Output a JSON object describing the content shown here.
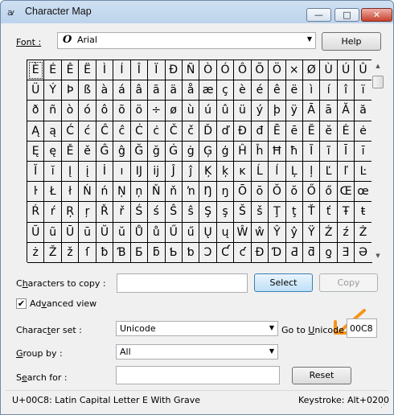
{
  "window": {
    "title": "Character Map",
    "icon": "charmap-icon",
    "controls": {
      "minimize": "—",
      "maximize": "□",
      "close": "✕"
    }
  },
  "font_label": "Font :",
  "font_value": "Arial",
  "font_glyph": "O",
  "help_label": "Help",
  "characters": [
    "È",
    "É",
    "Ê",
    "Ë",
    "Ì",
    "Í",
    "Î",
    "Ï",
    "Ð",
    "Ñ",
    "Ò",
    "Ó",
    "Ô",
    "Õ",
    "Ö",
    "×",
    "Ø",
    "Ù",
    "Ú",
    "Û",
    "Ü",
    "Ý",
    "Þ",
    "ß",
    "à",
    "á",
    "â",
    "ã",
    "ä",
    "å",
    "æ",
    "ç",
    "è",
    "é",
    "ê",
    "ë",
    "ì",
    "í",
    "î",
    "ï",
    "ð",
    "ñ",
    "ò",
    "ó",
    "ô",
    "õ",
    "ö",
    "÷",
    "ø",
    "ù",
    "ú",
    "û",
    "ü",
    "ý",
    "þ",
    "ÿ",
    "Ā",
    "ā",
    "Ă",
    "ă",
    "Ą",
    "ą",
    "Ć",
    "ć",
    "Ĉ",
    "ĉ",
    "Ċ",
    "ċ",
    "Č",
    "č",
    "Ď",
    "ď",
    "Đ",
    "đ",
    "Ē",
    "ē",
    "Ĕ",
    "ĕ",
    "Ė",
    "ė",
    "Ę",
    "ę",
    "Ě",
    "ě",
    "Ĝ",
    "ĝ",
    "Ğ",
    "ğ",
    "Ġ",
    "ġ",
    "Ģ",
    "ģ",
    "Ĥ",
    "ĥ",
    "Ħ",
    "ħ",
    "Ĩ",
    "ĩ",
    "Ī",
    "ī",
    "Ĭ",
    "ĭ",
    "Į",
    "į",
    "İ",
    "ı",
    "Ĳ",
    "ĳ",
    "Ĵ",
    "ĵ",
    "Ķ",
    "ķ",
    "ĸ",
    "Ĺ",
    "ĺ",
    "Ļ",
    "ļ",
    "Ľ",
    "ľ",
    "Ŀ",
    "ŀ",
    "Ł",
    "ł",
    "Ń",
    "ń",
    "Ņ",
    "ņ",
    "Ň",
    "ň",
    "ŉ",
    "Ŋ",
    "ŋ",
    "Ō",
    "ō",
    "Ŏ",
    "ŏ",
    "Ő",
    "ő",
    "Œ",
    "œ",
    "Ŕ",
    "ŕ",
    "Ŗ",
    "ŗ",
    "Ř",
    "ř",
    "Ś",
    "ś",
    "Ŝ",
    "ŝ",
    "Ş",
    "ş",
    "Š",
    "š",
    "Ţ",
    "ţ",
    "Ť",
    "ť",
    "Ŧ",
    "ŧ",
    "Ũ",
    "ũ",
    "Ū",
    "ū",
    "Ŭ",
    "ŭ",
    "Ů",
    "ů",
    "Ű",
    "ű",
    "Ų",
    "ų",
    "Ŵ",
    "ŵ",
    "Ŷ",
    "ŷ",
    "Ÿ",
    "Ź",
    "ź",
    "Ż",
    "ż",
    "Ž",
    "ž",
    "ſ",
    "ƀ",
    "Ɓ",
    "Ƃ",
    "ƃ",
    "Ƅ",
    "ƅ",
    "Ɔ",
    "Ƈ",
    "ƈ",
    "Ɖ",
    "Ɗ",
    "Ƌ",
    "ƌ",
    "ƍ",
    "Ǝ",
    "Ə"
  ],
  "selected_index": 0,
  "copy": {
    "label_pre": "C",
    "label_u": "h",
    "label_post": "aracters to copy :",
    "value": "",
    "select_label": "Select",
    "copy_label": "Copy"
  },
  "advanced": {
    "checked": "✔",
    "label_pre": "Ad",
    "label_u": "v",
    "label_post": "anced view"
  },
  "character_set": {
    "label_pre": "Charac",
    "label_u": "t",
    "label_post": "er set :",
    "value": "Unicode",
    "goto_pre": "Go to ",
    "goto_u": "U",
    "goto_post": "nicode :",
    "goto_value": "00C8"
  },
  "group_by": {
    "label_pre": "",
    "label_u": "G",
    "label_post": "roup by :",
    "value": "All"
  },
  "search": {
    "label_pre": "S",
    "label_u": "e",
    "label_post": "arch for :",
    "value": "",
    "reset_label": "Reset"
  },
  "status": {
    "description": "U+00C8: Latin Capital Letter E With Grave",
    "keystroke": "Keystroke: Alt+0200"
  },
  "annotation_color": "#f7941d"
}
